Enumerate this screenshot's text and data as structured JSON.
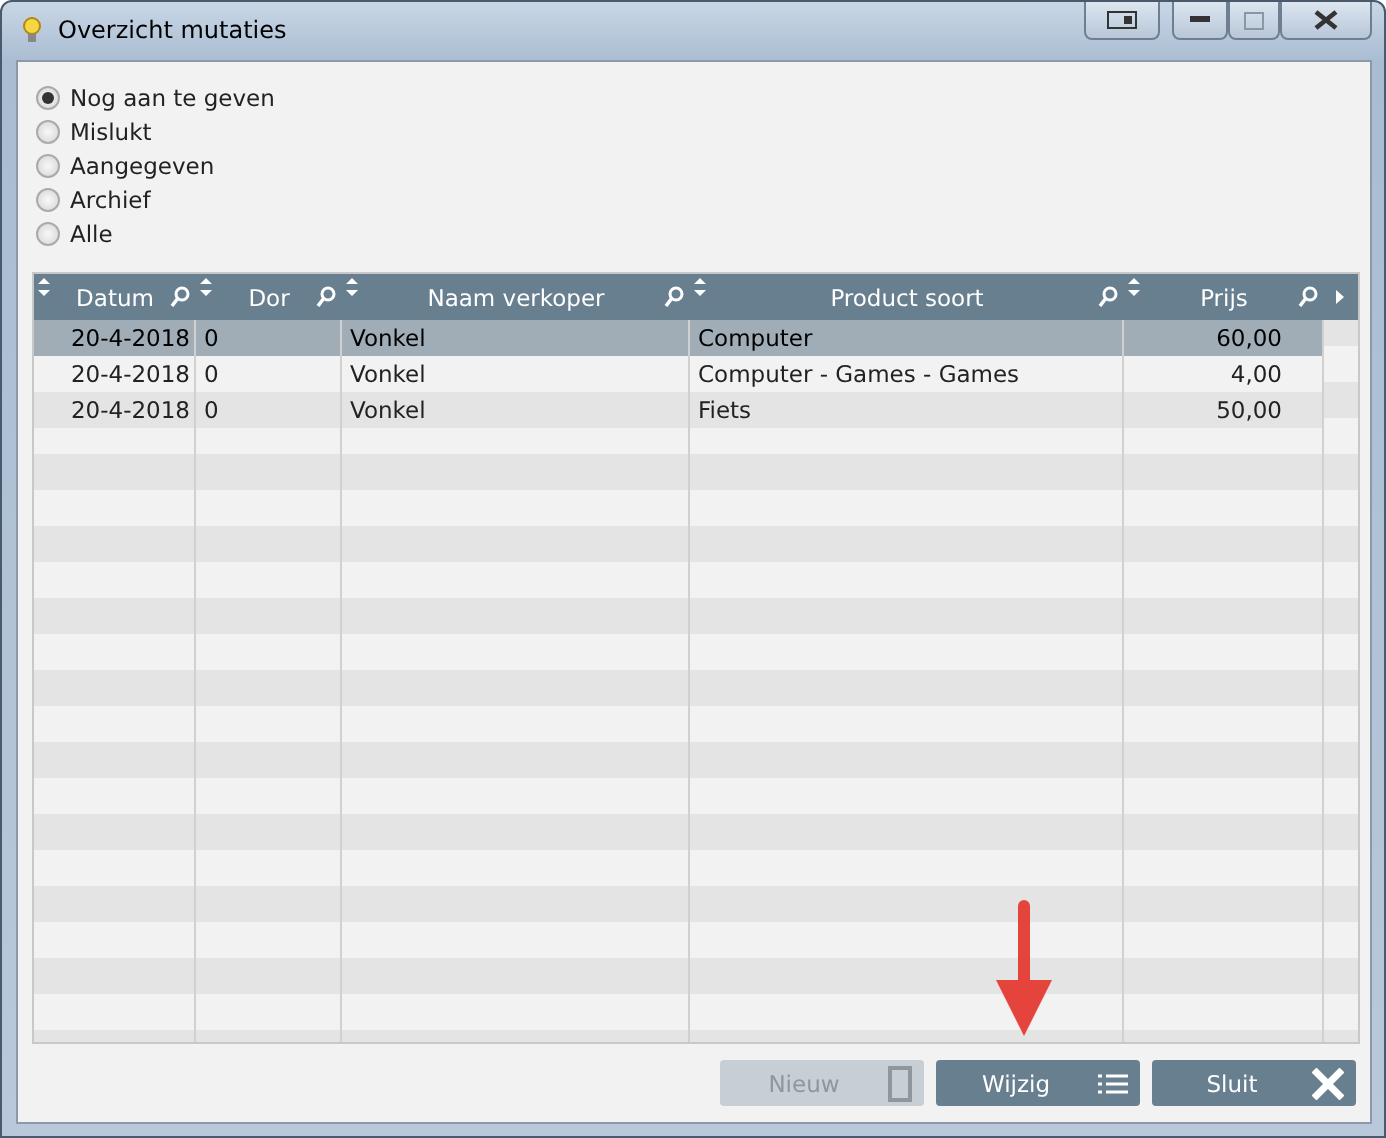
{
  "window": {
    "title": "Overzicht mutaties"
  },
  "filters": [
    {
      "label": "Nog aan te geven",
      "selected": true
    },
    {
      "label": "Mislukt",
      "selected": false
    },
    {
      "label": "Aangegeven",
      "selected": false
    },
    {
      "label": "Archief",
      "selected": false
    },
    {
      "label": "Alle",
      "selected": false
    }
  ],
  "table": {
    "columns": [
      {
        "label": "Datum"
      },
      {
        "label": "Dor"
      },
      {
        "label": "Naam verkoper"
      },
      {
        "label": "Product soort"
      },
      {
        "label": "Prijs"
      }
    ],
    "rows": [
      {
        "cells": [
          "20-4-2018",
          "0",
          "Vonkel",
          "Computer",
          "60,00"
        ],
        "selected": true
      },
      {
        "cells": [
          "20-4-2018",
          "0",
          "Vonkel",
          "Computer - Games - Games",
          "4,00"
        ],
        "selected": false
      },
      {
        "cells": [
          "20-4-2018",
          "0",
          "Vonkel",
          "Fiets",
          "50,00"
        ],
        "selected": false
      }
    ]
  },
  "buttons": [
    {
      "label": "Nieuw",
      "kind": "new",
      "disabled": true
    },
    {
      "label": "Wijzig",
      "kind": "edit",
      "disabled": false
    },
    {
      "label": "Sluit",
      "kind": "close",
      "disabled": false
    }
  ]
}
